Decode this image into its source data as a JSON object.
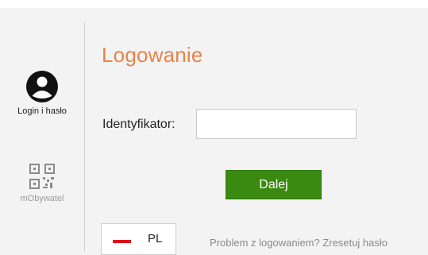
{
  "sidebar": {
    "methods": [
      {
        "label": "Login i hasło",
        "icon": "user-circle-icon"
      },
      {
        "label": "mObywatel",
        "icon": "qr-code-icon"
      }
    ]
  },
  "main": {
    "title": "Logowanie",
    "identifier_label": "Identyfikator:",
    "identifier_value": "",
    "next_button": "Dalej",
    "language": {
      "code": "PL",
      "icon": "poland-flag-icon"
    },
    "reset_link": "Problem z logowaniem? Zresetuj hasło"
  },
  "colors": {
    "accent": "#e8834a",
    "button": "#3a8a12",
    "background": "#f3f3f3"
  }
}
